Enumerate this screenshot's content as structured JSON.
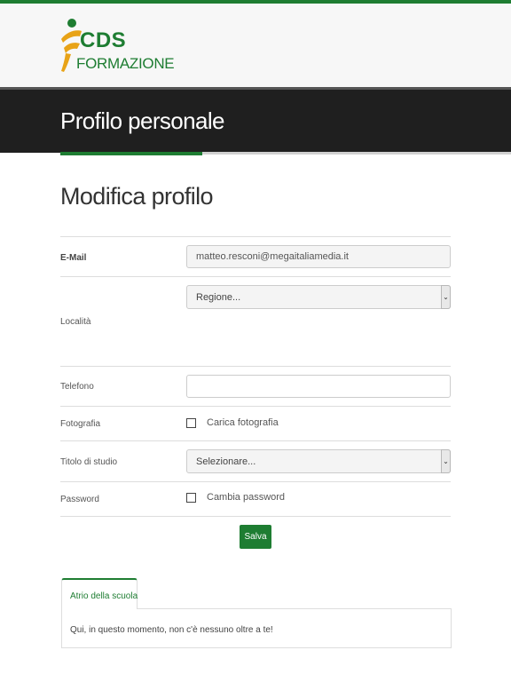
{
  "brand": {
    "logo_primary": "CDS",
    "logo_secondary": "FORMAZIONE",
    "color_green": "#1e7d32",
    "color_orange": "#e8a317"
  },
  "header": {
    "title": "Profilo personale"
  },
  "main": {
    "subtitle": "Modifica profilo",
    "form": {
      "email": {
        "label": "E-Mail",
        "value": "matteo.resconi@megaitaliamedia.it"
      },
      "location": {
        "label": "Località",
        "select_value": "Regione..."
      },
      "phone": {
        "label": "Telefono",
        "value": ""
      },
      "photo": {
        "label": "Fotografia",
        "checkbox_label": "Carica fotografia",
        "checked": false
      },
      "education": {
        "label": "Titolo di studio",
        "select_value": "Selezionare..."
      },
      "password": {
        "label": "Password",
        "checkbox_label": "Cambia password",
        "checked": false
      },
      "save_label": "Salva"
    },
    "school": {
      "tab_label": "Atrio della scuola",
      "message": "Qui, in questo momento, non c'è nessuno oltre a te!"
    }
  }
}
